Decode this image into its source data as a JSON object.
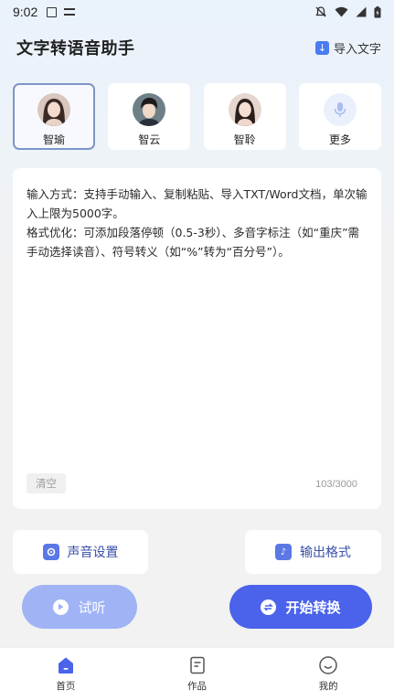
{
  "status_bar": {
    "time": "9:02",
    "icons": [
      "a-icon",
      "keyboard-icon",
      "mute-icon",
      "wifi-icon",
      "signal-icon",
      "battery-icon"
    ]
  },
  "header": {
    "title": "文字转语音助手",
    "import_label": "导入文字"
  },
  "voices": [
    {
      "name": "智瑜",
      "selected": true
    },
    {
      "name": "智云",
      "selected": false
    },
    {
      "name": "智聆",
      "selected": false
    },
    {
      "name": "更多",
      "selected": false
    }
  ],
  "editor": {
    "text": "输入方式：支持手动输入、复制粘贴、导入TXT/Word文档，单次输入上限为5000字。\n格式优化：可添加段落停顿（0.5-3秒）、多音字标注（如“重庆”需手动选择读音）、符号转义（如“%”转为“百分号”）。",
    "clear_label": "清空",
    "char_count": "103/3000"
  },
  "options": {
    "voice_settings_label": "声音设置",
    "output_format_label": "输出格式"
  },
  "actions": {
    "preview_label": "试听",
    "convert_label": "开始转换"
  },
  "tabbar": {
    "tabs": [
      {
        "label": "首页",
        "active": true
      },
      {
        "label": "作品",
        "active": false
      },
      {
        "label": "我的",
        "active": false
      }
    ]
  },
  "colors": {
    "accent": "#4a63ea",
    "accent_light": "#9fb3f5",
    "selected_border": "#7e95c6"
  }
}
